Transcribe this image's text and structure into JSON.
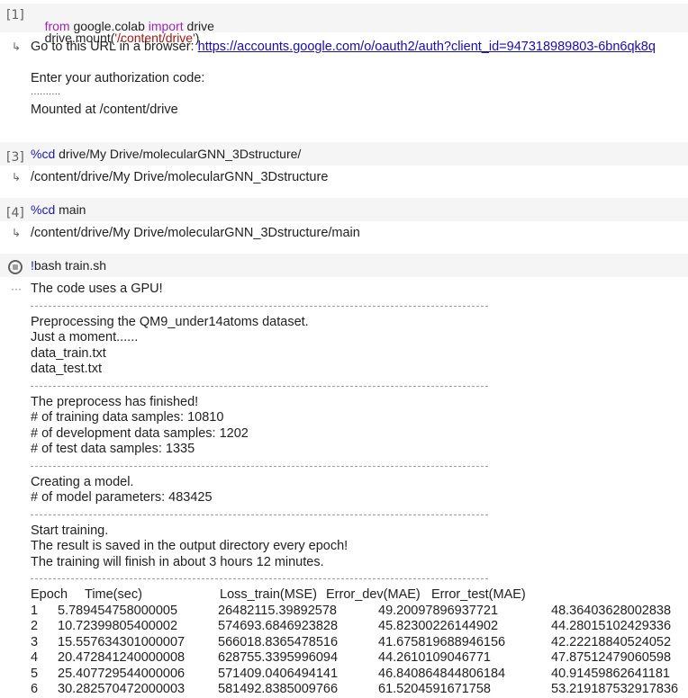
{
  "cells": [
    {
      "prompt": "[1]",
      "code_line1": {
        "kw_from": "from",
        "module": " google.colab ",
        "kw_import": "import",
        "name": " drive"
      },
      "code_line2": {
        "call": "drive.mount(",
        "arg": "'/content/drive'",
        "close": ")"
      },
      "output": {
        "line1_prefix": "Go to this URL in a browser: ",
        "line1_link": "https://accounts.google.com/o/oauth2/auth?client_id=947318989803-6bn6qk8q",
        "line2": "Enter your authorization code:",
        "line3": "··········",
        "line4": "Mounted at /content/drive"
      }
    },
    {
      "prompt": "[3]",
      "magic": "%cd",
      "arg": " drive/My Drive/molecularGNN_3Dstructure/",
      "output": "/content/drive/My Drive/molecularGNN_3Dstructure"
    },
    {
      "prompt": "[4]",
      "magic": "%cd",
      "arg": " main",
      "output": "/content/drive/My Drive/molecularGNN_3Dstructure/main"
    },
    {
      "bang": "!",
      "command": "bash train.sh",
      "output_icon": "···"
    }
  ],
  "log": {
    "gpu": "The code uses a GPU!",
    "pre1": "Preprocessing the QM9_under14atoms dataset.",
    "pre2": "Just a moment......",
    "pre3": "data_train.txt",
    "pre4": "data_test.txt",
    "fin1": "The preprocess has finished!",
    "fin2": "# of training data samples: 10810",
    "fin3": "# of development data samples: 1202",
    "fin4": "# of test data samples: 1335",
    "model1": "Creating a model.",
    "model2": "# of model parameters: 483425",
    "train1": "Start training.",
    "train2": "The result is saved in the output directory every epoch!",
    "train3": "The training will finish in about 3 hours 12 minutes.",
    "header": [
      "Epoch",
      "Time(sec)",
      "Loss_train(MSE)",
      "Error_dev(MAE)",
      "Error_test(MAE)",
      ""
    ],
    "rows": [
      [
        "1",
        "5.789454758000005",
        "26482115.39892578",
        "49.20097896937721",
        "48.36403628002838"
      ],
      [
        "2",
        "10.72399805400002",
        "574693.6846923828",
        "45.82300226144902",
        "44.28015102429336"
      ],
      [
        "3",
        "15.557634301000007",
        "566018.8365478516",
        "41.675819688946156",
        "42.22218840524052"
      ],
      [
        "4",
        "20.472841240000008",
        "628755.3395996094",
        "44.2610109046771",
        "47.87512479060598"
      ],
      [
        "5",
        "25.407729544000006",
        "571409.0406494141",
        "46.840864844806184",
        "40.91459862641181"
      ],
      [
        "6",
        "30.282570472000003",
        "581492.8385009766",
        "61.5204591671758",
        "53.219187532917836"
      ]
    ]
  },
  "icons": {
    "output": "output-arrow-icon",
    "run": "running-spinner-icon"
  }
}
